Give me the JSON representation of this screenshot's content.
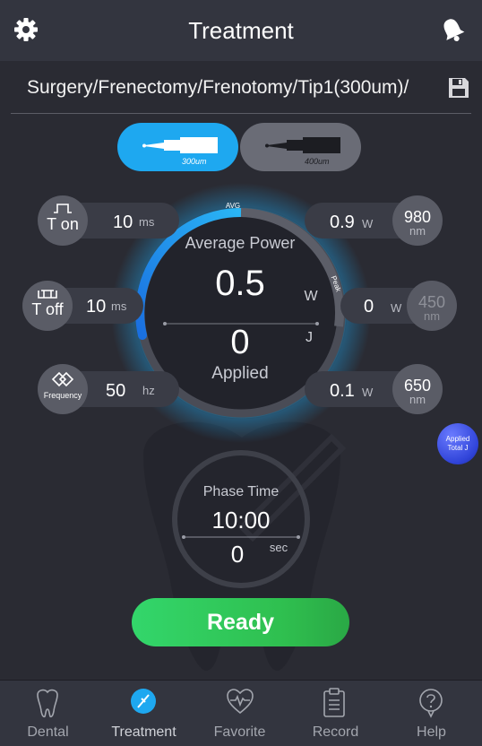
{
  "header": {
    "title": "Treatment",
    "settings_icon": "gear-icon",
    "bell_icon": "bell-icon"
  },
  "treatment_path": "Surgery/Frenectomy/Frenotomy/Tip1(300um)/",
  "tips": [
    {
      "label": "300um",
      "selected": true
    },
    {
      "label": "400um",
      "selected": false
    }
  ],
  "params": {
    "t_on": {
      "label": "T on",
      "value": "10",
      "unit": "ms"
    },
    "t_off": {
      "label": "T off",
      "value": "10",
      "unit": "ms"
    },
    "frequency": {
      "label": "Frequency",
      "value": "50",
      "unit": "hz"
    }
  },
  "wavelengths": [
    {
      "value": "980",
      "unit": "nm",
      "power": "0.9",
      "power_unit": "W",
      "enabled": true
    },
    {
      "value": "450",
      "unit": "nm",
      "power": "0",
      "power_unit": "W",
      "enabled": false
    },
    {
      "value": "650",
      "unit": "nm",
      "power": "0.1",
      "power_unit": "W",
      "enabled": true
    }
  ],
  "gauge": {
    "avg_tag": "AVG",
    "peak_tag": "Peak",
    "avg_label": "Average Power",
    "avg_value": "0.5",
    "avg_unit": "W",
    "energy_value": "0",
    "energy_unit": "J",
    "applied_label": "Applied"
  },
  "phase": {
    "label": "Phase Time",
    "time": "10:00",
    "seconds": "0",
    "seconds_unit": "sec"
  },
  "applied_total_button": {
    "line1": "Applied",
    "line2": "Total J"
  },
  "ready_button": "Ready",
  "colors": {
    "accent": "#1ea8f0",
    "ready": "#33cc5a",
    "background": "#2a2b33"
  },
  "nav": [
    {
      "label": "Dental",
      "icon": "tooth-icon",
      "active": false
    },
    {
      "label": "Treatment",
      "icon": "treatment-icon",
      "active": true
    },
    {
      "label": "Favorite",
      "icon": "heart-pulse-icon",
      "active": false
    },
    {
      "label": "Record",
      "icon": "clipboard-icon",
      "active": false
    },
    {
      "label": "Help",
      "icon": "help-icon",
      "active": false
    }
  ]
}
